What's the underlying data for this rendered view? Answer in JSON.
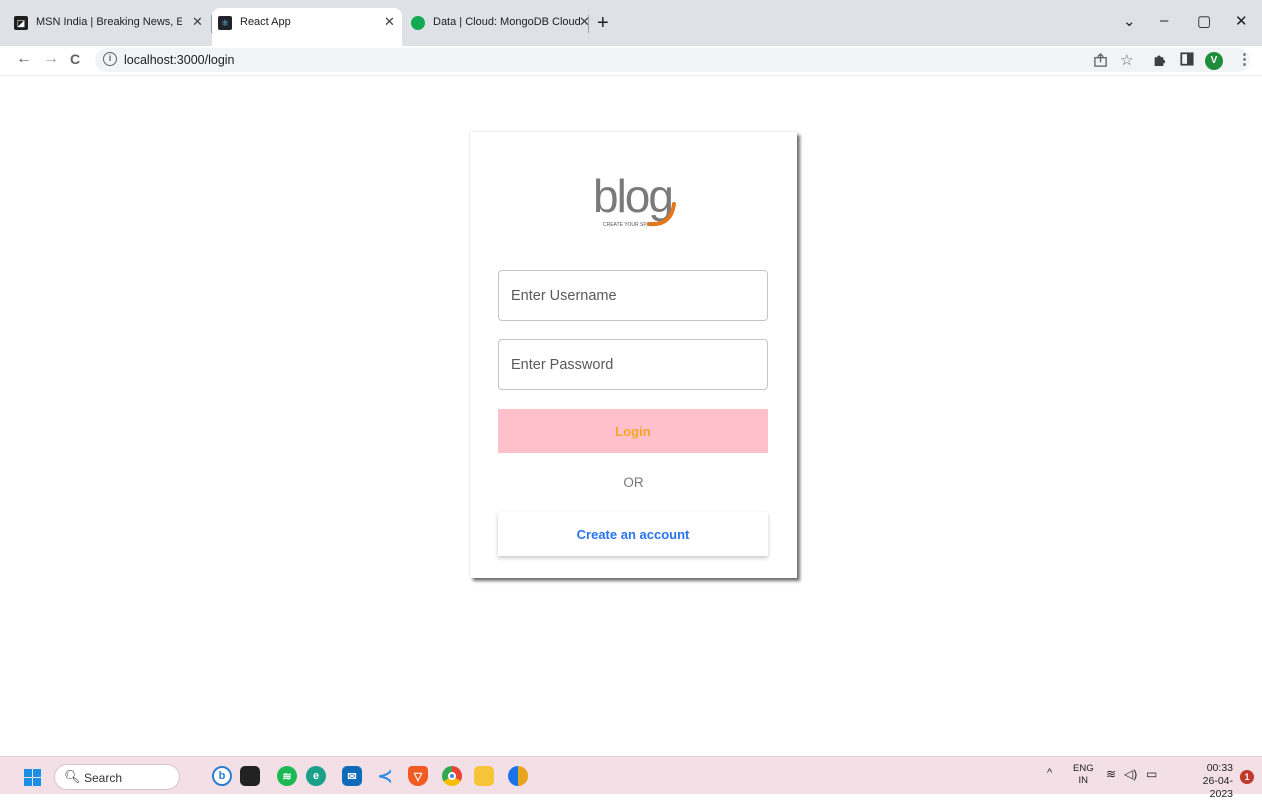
{
  "browser": {
    "tabs": [
      {
        "title": "MSN India | Breaking News, Ente",
        "close": "✕"
      },
      {
        "title": "React App",
        "close": "✕"
      },
      {
        "title": "Data | Cloud: MongoDB Cloud",
        "close": "✕"
      }
    ],
    "new_tab": "+",
    "window_controls": {
      "chevron": "⌄",
      "minimize": "–",
      "restore": "▢",
      "close": "✕"
    },
    "nav": {
      "back": "←",
      "forward": "→",
      "reload": "C"
    },
    "url": "localhost:3000/login",
    "profile_initial": "V",
    "toolbar_icons": [
      "share-icon",
      "star-icon",
      "extensions-icon",
      "sidepanel-icon"
    ]
  },
  "login": {
    "logo_text": "blog",
    "logo_tagline": "CREATE YOUR SPACE",
    "username_placeholder": "Enter Username",
    "password_placeholder": "Enter Password",
    "login_label": "Login",
    "or_text": "OR",
    "create_label": "Create an account",
    "colors": {
      "login_bg": "#ffc0cb",
      "login_text": "#f5a623",
      "create_text": "#2874f0",
      "logo_accent": "#e4761b"
    }
  },
  "taskbar": {
    "search_label": "Search",
    "apps": [
      "bing-icon",
      "app-icon",
      "spotify-icon",
      "edge-icon",
      "mail-icon",
      "vscode-icon",
      "brave-icon",
      "chrome-icon",
      "file-explorer-icon",
      "chrome-canary-icon"
    ],
    "language_top": "ENG",
    "language_bottom": "IN",
    "time": "00:33",
    "date": "26-04-2023",
    "notification_count": "1"
  }
}
